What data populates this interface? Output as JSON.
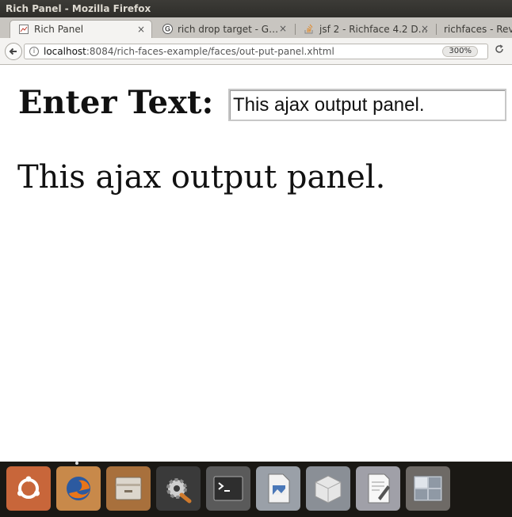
{
  "window": {
    "title": "Rich Panel - Mozilla Firefox"
  },
  "tabs": [
    {
      "label": "Rich Panel",
      "icon": "page-icon",
      "active": true
    },
    {
      "label": "rich drop target - G…",
      "icon": "google-icon"
    },
    {
      "label": "jsf 2 - Richface 4.2 D…",
      "icon": "stackoverflow-icon"
    },
    {
      "label": "richfaces - Revis",
      "icon": "page-icon"
    }
  ],
  "tab_close_glyph": "×",
  "navbar": {
    "url_host": "localhost",
    "url_rest": ":8084/rich-faces-example/faces/out-put-panel.xhtml",
    "zoom": "300%"
  },
  "form": {
    "label": "Enter Text:",
    "input_value": "This ajax output panel."
  },
  "output": {
    "text": "This ajax output panel."
  },
  "dock": [
    {
      "name": "ubuntu-dash-icon",
      "color": "#c8663a"
    },
    {
      "name": "firefox-icon",
      "color": "#c88a4a"
    },
    {
      "name": "files-icon",
      "color": "#a8703c"
    },
    {
      "name": "system-settings-icon",
      "color": "#3a3a3a"
    },
    {
      "name": "terminal-icon",
      "color": "#4a4a4a"
    },
    {
      "name": "image-viewer-icon",
      "color": "#9aa0a8"
    },
    {
      "name": "virtualbox-icon",
      "color": "#8a8f96"
    },
    {
      "name": "text-editor-icon",
      "color": "#9a9aa0"
    },
    {
      "name": "workspace-switcher-icon",
      "color": "#6e6a66"
    }
  ]
}
